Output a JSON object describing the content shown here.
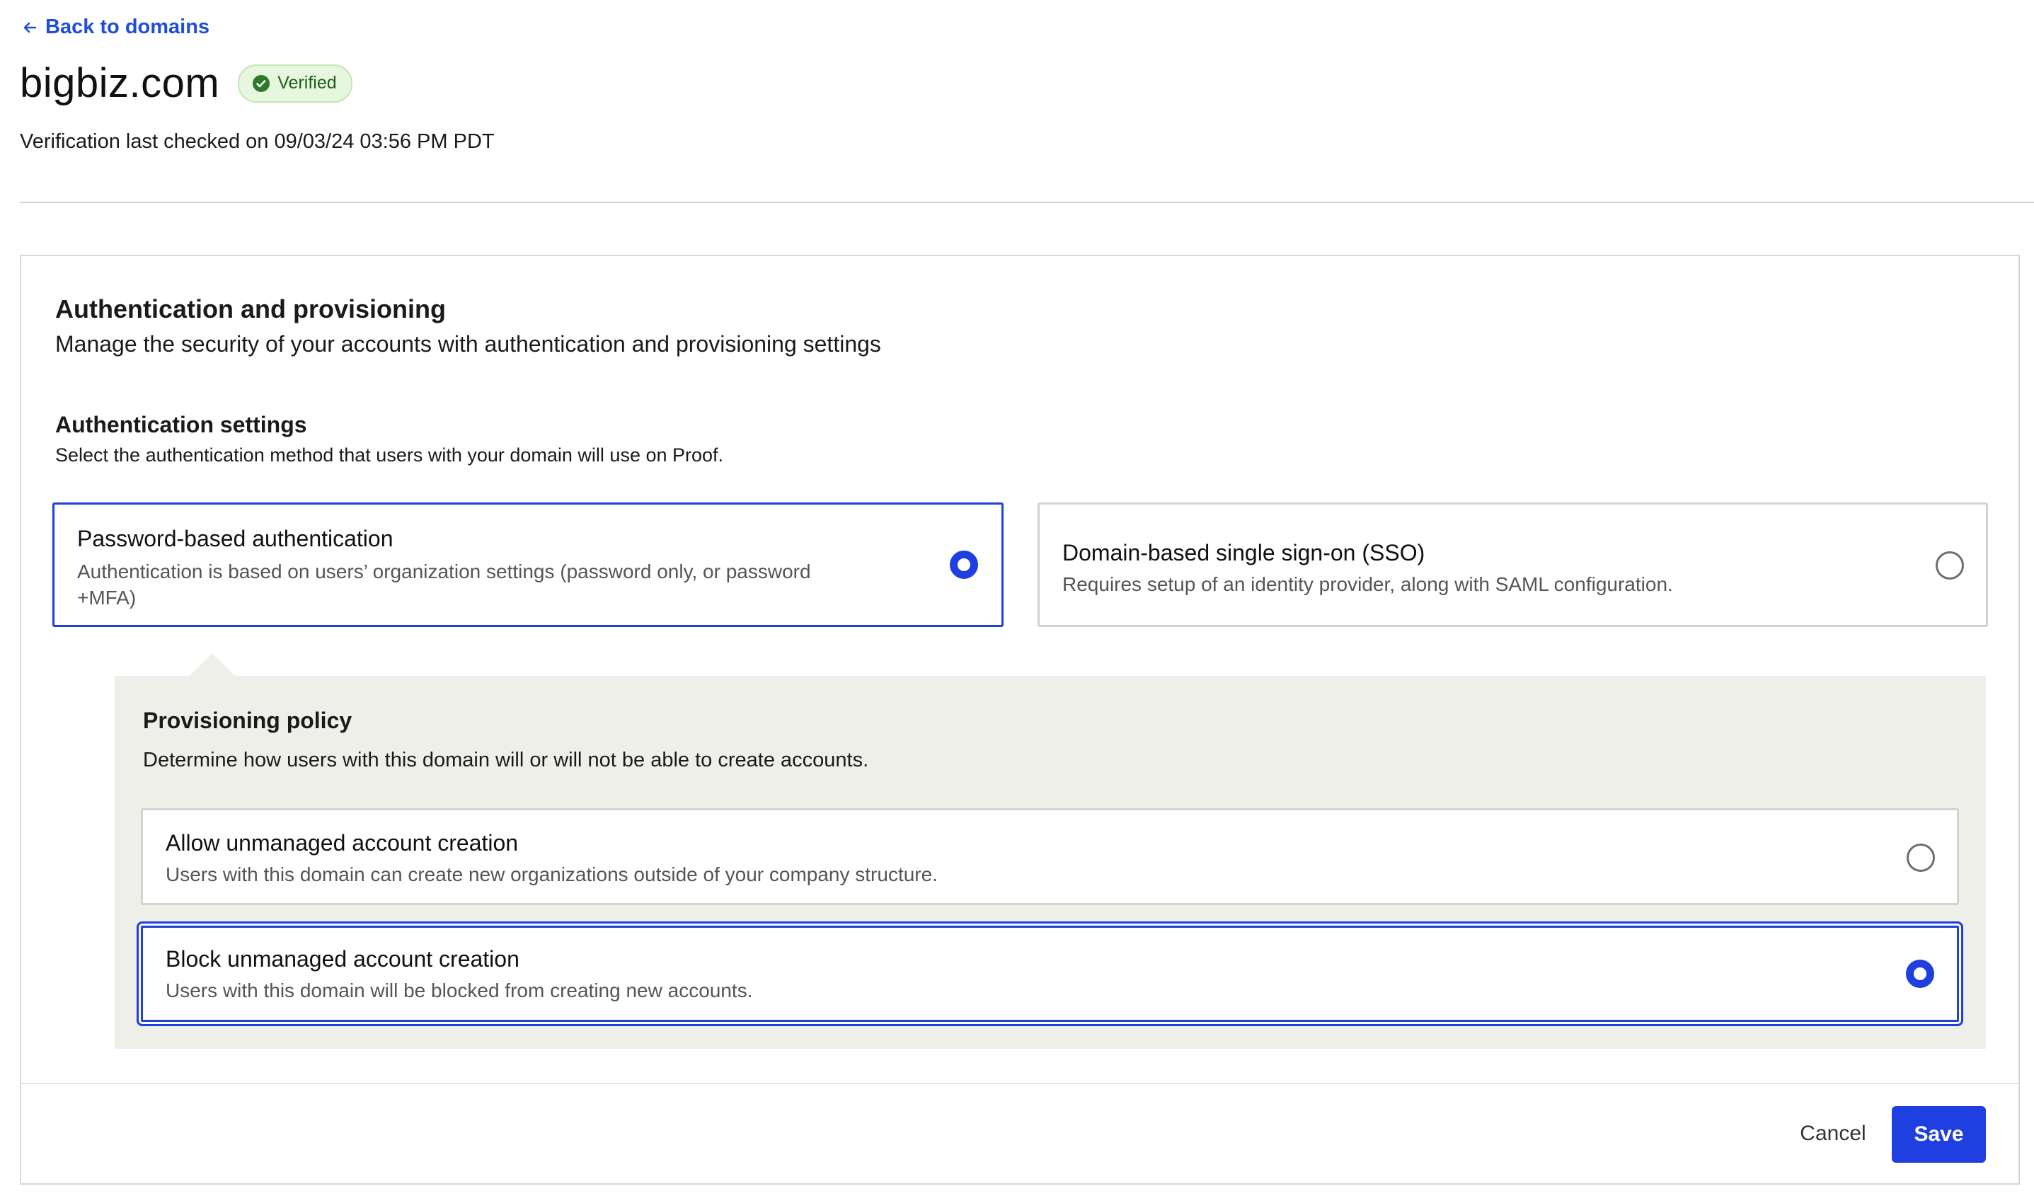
{
  "header": {
    "back_link": "Back to domains",
    "title": "bigbiz.com",
    "badge": "Verified",
    "verification_text": "Verification last checked on 09/03/24 03:56 PM PDT"
  },
  "section": {
    "title": "Authentication and provisioning",
    "subtitle": "Manage the security of your accounts with authentication and provisioning settings"
  },
  "auth": {
    "title": "Authentication settings",
    "subtitle": "Select the authentication method that users with your domain will use on Proof.",
    "options": [
      {
        "title": "Password-based authentication",
        "desc_line1": "Authentication is based on users’ organization settings (password only, or password",
        "desc_line2": "+MFA)",
        "selected": true
      },
      {
        "title": "Domain-based single sign-on (SSO)",
        "desc": "Requires setup of an identity provider, along with SAML configuration.",
        "selected": false
      }
    ]
  },
  "provisioning": {
    "title": "Provisioning policy",
    "subtitle": "Determine how users with this domain will or will not be able to create accounts.",
    "options": [
      {
        "title": "Allow unmanaged account creation",
        "desc": "Users with this domain can create new organizations outside of your company structure.",
        "selected": false
      },
      {
        "title": "Block unmanaged account creation",
        "desc": "Users with this domain will be blocked from creating new accounts.",
        "selected": true
      }
    ]
  },
  "footer": {
    "cancel": "Cancel",
    "save": "Save"
  },
  "colors": {
    "accent": "#1f3fe0",
    "link": "#1f4fd8",
    "badge_bg": "#e7f6df",
    "panel_bg": "#efefea"
  }
}
